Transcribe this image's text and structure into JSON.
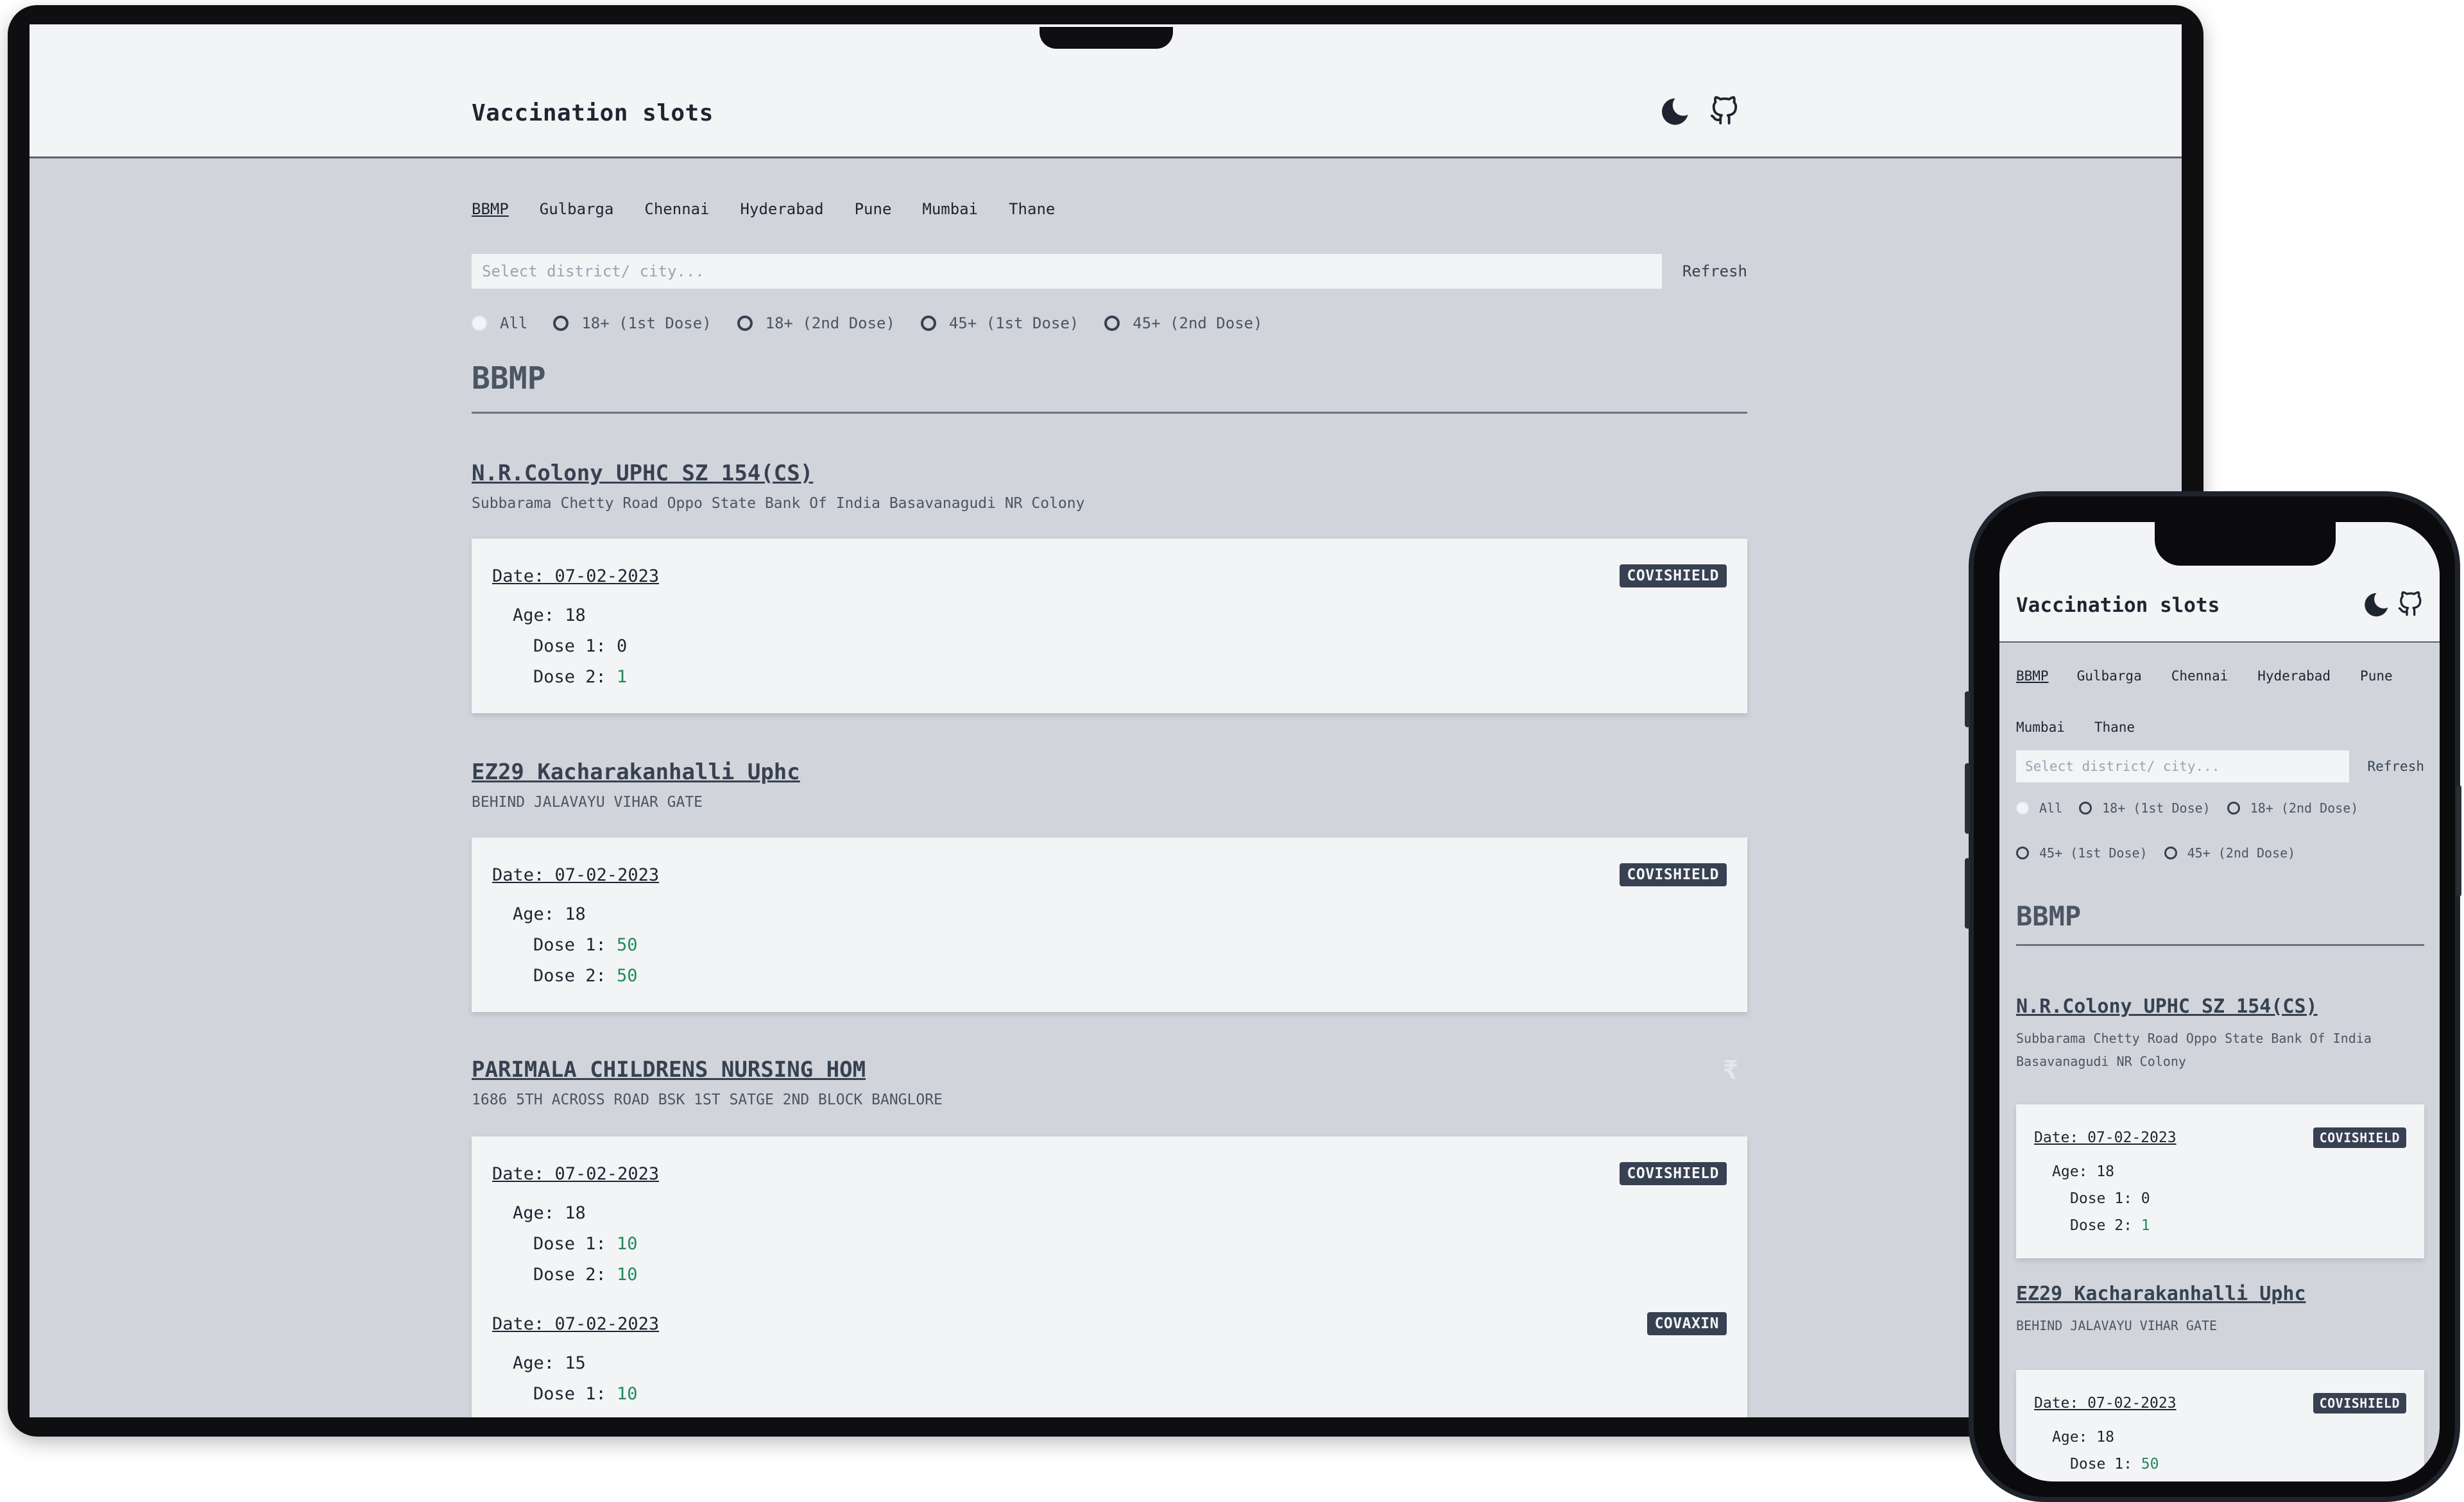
{
  "app": {
    "title": "Vaccination slots",
    "icons": {
      "theme_toggle": "moon-icon",
      "repo": "github-icon"
    }
  },
  "tabs": [
    "BBMP",
    "Gulbarga",
    "Chennai",
    "Hyderabad",
    "Pune",
    "Mumbai",
    "Thane"
  ],
  "active_tab": "BBMP",
  "search": {
    "placeholder": "Select district/ city...",
    "value": ""
  },
  "refresh_label": "Refresh",
  "filters": [
    "All",
    "18+ (1st Dose)",
    "18+ (2nd Dose)",
    "45+ (1st Dose)",
    "45+ (2nd Dose)"
  ],
  "selected_filter": "All",
  "district": "BBMP",
  "labels": {
    "age": "Age: ",
    "dose1": "Dose 1: ",
    "dose2": "Dose 2: "
  },
  "centers": [
    {
      "name": "N.R.Colony UPHC SZ 154(CS)",
      "address": "Subbarama Chetty Road Oppo State Bank Of India Basavanagudi NR Colony",
      "sessions": [
        {
          "date": "Date: 07-02-2023",
          "vaccine": "COVISHIELD",
          "age": "18",
          "dose1": "0",
          "dose2": "1"
        }
      ]
    },
    {
      "name": "EZ29 Kacharakanhalli Uphc",
      "address": "BEHIND JALAVAYU VIHAR GATE",
      "sessions": [
        {
          "date": "Date: 07-02-2023",
          "vaccine": "COVISHIELD",
          "age": "18",
          "dose1": "50",
          "dose2": "50"
        }
      ]
    },
    {
      "name": "PARIMALA CHILDRENS NURSING HOM",
      "address": "1686 5TH ACROSS ROAD BSK 1ST SATGE 2ND BLOCK BANGLORE",
      "fee_symbol": "₹",
      "sessions": [
        {
          "date": "Date: 07-02-2023",
          "vaccine": "COVISHIELD",
          "age": "18",
          "dose1": "10",
          "dose2": "10"
        },
        {
          "date": "Date: 07-02-2023",
          "vaccine": "COVAXIN",
          "age": "15",
          "dose1": "10"
        }
      ]
    }
  ],
  "colors": {
    "page_bg": "#d1d5db",
    "header_bg": "#f3f4f6",
    "badge_bg": "#374151",
    "available": "#1f8a5a"
  }
}
